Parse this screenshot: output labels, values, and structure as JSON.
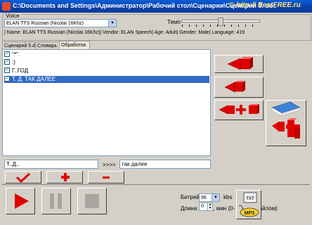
{
  "window": {
    "title": "C:\\Documents and Settings\\Администратор\\Рабочий стол\\Сценарии\\Сценарий 5. doc",
    "watermark": "© http:// BestFREE.ru"
  },
  "voice": {
    "group_label": "Voice",
    "selected": "ELAN TTS Russian (Nicolai 16Khz)",
    "tempo_label": "Темп",
    "info": "| Name: ELAN TTS Russian (Nicolai 16Khz)| Vendor: ELAN Speech| Age: Adult| Gender: Male| Language: 419"
  },
  "tabs": [
    {
      "label": "Сценарий 5.doc"
    },
    {
      "label": "Словарь"
    },
    {
      "label": "Обработка"
    }
  ],
  "list": {
    "items": [
      {
        "text": "\"*\".",
        "checked": true
      },
      {
        "text": ":)",
        "checked": true
      },
      {
        "text": "Г..ГОД",
        "checked": true
      },
      {
        "text": "Т.  Д.  ТАК ДАЛЕЕ",
        "checked": true,
        "selected": true
      }
    ]
  },
  "edit": {
    "source_value": "Т..Д..",
    "arrows": ">>>>",
    "target_value": "так далее"
  },
  "bitrate": {
    "label": "Битрейт",
    "value": "96",
    "unit": "kbs"
  },
  "part_length": {
    "label": "Длина части, мин (0- одним файлом)",
    "value": "0"
  },
  "format_icons": {
    "txt": "TXT",
    "mp3": "MP3"
  },
  "colors": {
    "title_bar": "#0a4fc8",
    "red_icon": "#e00000",
    "selection": "#316ac5",
    "background": "#d4d0c8"
  }
}
